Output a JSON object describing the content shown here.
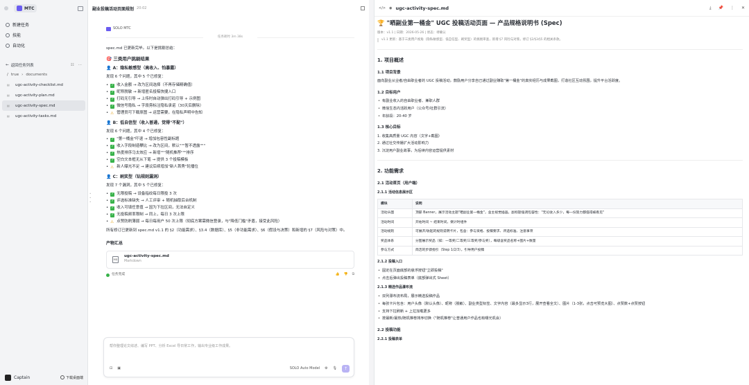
{
  "sidebar": {
    "workspace": "MTC",
    "nav": [
      {
        "label": "新建任务",
        "icon": "new-task-icon"
      },
      {
        "label": "技能",
        "icon": "skills-icon"
      },
      {
        "label": "自动化",
        "icon": "automation-icon"
      }
    ],
    "section_title": "返回任务列表",
    "path": [
      "/",
      "true",
      "documents"
    ],
    "files": [
      "ugc-activity-checklist.md",
      "ugc-activity-plan.md",
      "ugc-activity-spec.md",
      "ugc-activity-tasks.md"
    ],
    "active_file": "ugc-activity-spec.md",
    "user": "Captain",
    "download_label": "下载桌面端"
  },
  "chat": {
    "title": "副业投稿活动页面规划",
    "time": "20:02",
    "agent": "SOLO MTC",
    "elapsed": "任务耗时 3m 38s",
    "intro": "spec.md 已更新完毕。以下是挑剔总结：",
    "h_users": "三类用户挑剔结果",
    "groups": [
      {
        "title": "A：隐私敏感型（高收入、怕暴露）",
        "summary": "发现 6 个问题，其中 5 个已修复：",
        "items": [
          {
            "s": "ok",
            "t": "收入金额 → 改为区间选择（不再存储精确值）"
          },
          {
            "s": "ok",
            "t": "昵称脱敏 → 新增匿名投稿快捷入口"
          },
          {
            "s": "ok",
            "t": "打码无引导 → 上传时自动弹出打码引导 + 示例图"
          },
          {
            "s": "ok",
            "t": "微信号隐私 → 字段旁标注隐私承诺（30天后删除）"
          },
          {
            "s": "warn",
            "t": "管理员可下载原图 → 运营需要，在隐私声明中告知"
          }
        ]
      },
      {
        "title": "B：低自信型（收入普通，觉得\"不配\"）",
        "summary": "发现 6 个问题，其中 4 个已修复：",
        "items": [
          {
            "s": "ok",
            "t": "\"第一桶金\"吓退 → 增加包容性副标题"
          },
          {
            "s": "ok",
            "t": "收入字段制造攀比 → 改为区间，默认\"\"\"暂不透露\"\"\""
          },
          {
            "s": "ok",
            "t": "热度排序马太效应 → 新增\"\"\"随机推荐\"\"\"排序"
          },
          {
            "s": "ok",
            "t": "空白文本框无从下笔 → 提供 3 个投稿模板"
          },
          {
            "s": "warn",
            "t": "新人曝光不足 → 建议后续增加\"新人首秀\"轮播位"
          }
        ]
      },
      {
        "title": "C：刷奖型（钻规则漏洞）",
        "summary": "发现 7 个漏洞，其中 5 个已修复：",
        "items": [
          {
            "s": "ok",
            "t": "无限投稿 → 设备指纹每日限投 3 次"
          },
          {
            "s": "ok",
            "t": "评选标准缺失 → 人工评审 + 随机抽取后台机制"
          },
          {
            "s": "ok",
            "t": "收入可填任意值 → 因为下拉区间，无法自定义"
          },
          {
            "s": "ok",
            "t": "无投稿频率限制 → 同上，每日 3 次上限"
          },
          {
            "s": "warn",
            "t": "点赞防刷薄弱 → 每日每用户 50 次上限（彻底方案需微信登录，与\"降低门槛\"矛盾，接受此风险）"
          }
        ]
      }
    ],
    "footer_text": "所有修订已更新到 spec.md v1.1 的 §2（功能需求）、§3.4（数据库）、§5（非功能需求）、§6（假设与决策）和新增的 §7（风险与对策）中。",
    "artifacts_title": "产物汇总",
    "artifact": {
      "name": "ugc-activity-spec.md",
      "type": "Markdown",
      "badge": "MD"
    },
    "done": "任务完成",
    "composer_placeholder": "帮你整理论文综述、编写 PPT、分析 Excel 导日常工作，输出专业级工作成果。",
    "model": "SOLO Auto Model"
  },
  "doc": {
    "tab": "ugc-activity-spec.md",
    "title": "\"晒副业第一桶金\" UGC 投稿活动页面 — 产品规格说明书 (Spec)",
    "meta": "版本：v1.1 | 日期：2026-05-26 | 状态：待确认",
    "note": "v1.1 更新：基于三类用户视角（隐私敏感型、低自信型、刷奖型）的挑剔审查，新增 §7 风险与对策，修订 §2/§3/§5 的相关条款。",
    "s1": "1. 项目概述",
    "s11": "1.1 项目背景",
    "s11_text": "面向副业从业者/自由职业者的 UGC 投稿活动，鼓励用户分享自己通过副业赚取\"第一桶金\"的真实经历与成果截图，打造社区互动氛围，提升平台活跃度。",
    "s12": "1.2 目标用户",
    "s12_items": [
      "有副业收入的自由职业者、兼职人群",
      "微信生态内活跃用户（公众号/社群引流）",
      "年龄段：20-40 岁"
    ],
    "s13": "1.3 核心目标",
    "s13_items": [
      "1. 收集高质量 UGC 内容（文字+截图）",
      "2. 通过社交传播扩大活动影响力",
      "3. 沉淀用户副业故事，为后续内容运营提供素材"
    ],
    "s2": "2. 功能需求",
    "s21": "2.1 活动首页（用户端）",
    "s211": "2.1.1 活动信息展示区",
    "table_head": [
      "模块",
      "说明"
    ],
    "table_rows": [
      [
        "活动头图",
        "顶部 Banner，展示活动主题\"晒副业第一桶金\"，含主视觉插画。副标题强调包容性：\"无论收入多少，每一份努力都值得被看见\""
      ],
      [
        "活动时间",
        "开始时间 ~ 结束时间，倒计时组件"
      ],
      [
        "活动规则",
        "可展开/收起的规则说明卡片，包含：参与资格、投稿要求、评选标准、注意事项"
      ],
      [
        "奖品体系",
        "分图展示奖品（如：一等奖/二等奖/三等奖/参与奖），每级含奖品名称+图片+数量"
      ],
      [
        "参与方式",
        "简洁的步骤指引（Step 1/2/3），引导用户投稿"
      ]
    ],
    "s212": "2.1.2 投稿入口",
    "s212_items": [
      "固定在页面底部的悬浮按钮\"立即投稿\"",
      "点击后弹出投稿表单（底部弹出式 Sheet）"
    ],
    "s213": "2.1.3 精选作品瀑布流",
    "s213_items": [
      "双列瀑布流布局，展示精选投稿作品",
      "每张卡片包含：用户头像（默认头像）、昵称（脱敏）、副业类型标签、文字内容（最多显示3行，展开查看全文）、图片（1-3张，点击可预览大图）、点赞数+点赞按钮",
      "支持下拉刷新 + 上拉加载更多",
      "按最新/最热/随机推荐排序切换（\"随机推荐\"让普通用户作品也有曝光机会）"
    ],
    "s22": "2.2 投稿功能",
    "s221": "2.2.1 投稿表单"
  }
}
